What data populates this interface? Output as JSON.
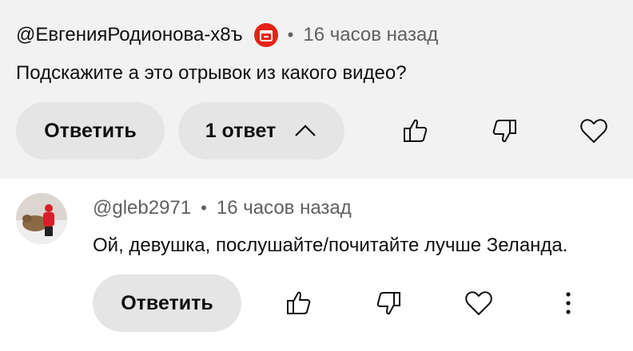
{
  "parent_comment": {
    "author": "@ЕвгенияРодионова-х8ъ",
    "sponsor_icon": "gift-icon",
    "separator": "•",
    "time": "16 часов назад",
    "text": "Подскажите а это отрывок из какого видео?",
    "reply_label": "Ответить",
    "replies_label": "1 ответ",
    "replies_icon": "chevron-up-icon",
    "actions": [
      "thumb-up-icon",
      "thumb-down-icon",
      "heart-icon"
    ]
  },
  "reply_comment": {
    "author": "@gleb2971",
    "separator": "•",
    "time": "16 часов назад",
    "text": "Ой, девушка, послушайте/почитайте лучше Зеланда.",
    "reply_label": "Ответить",
    "actions": [
      "thumb-up-icon",
      "thumb-down-icon",
      "heart-icon",
      "more-vert-icon"
    ]
  },
  "colors": {
    "sponsor_badge": "#e62117",
    "secondary_text": "#606060",
    "pill_bg": "#e5e5e5",
    "highlight_bg": "#f2f2f2"
  }
}
